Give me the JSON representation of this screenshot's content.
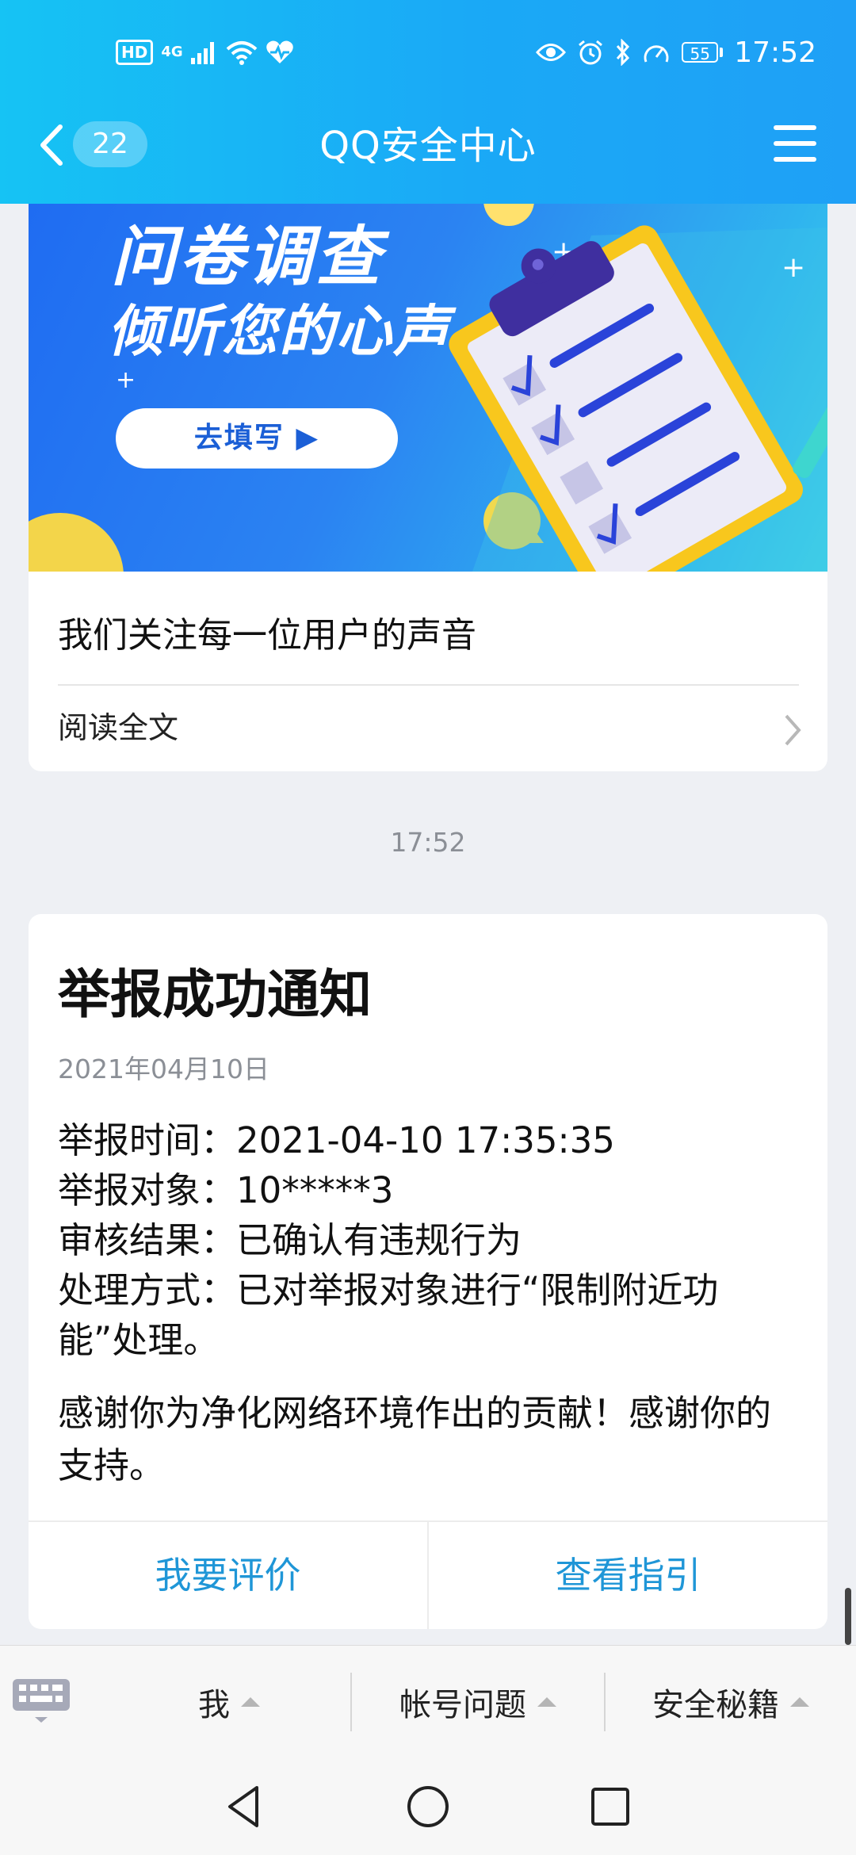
{
  "status_bar": {
    "left_icons": [
      "hd-icon",
      "4g-signal-icon",
      "wifi-icon",
      "heart-health-icon"
    ],
    "hd_label": "HD",
    "network_label": "4G",
    "right_icons": [
      "eye-icon",
      "alarm-icon",
      "bluetooth-icon",
      "speed-icon"
    ],
    "battery": "55",
    "time": "17:52"
  },
  "header": {
    "unread_count": "22",
    "title": "QQ安全中心"
  },
  "survey_card": {
    "banner_title": "问卷调查",
    "banner_subtitle": "倾听您的心声",
    "fill_button": "去填写 ▶",
    "description": "我们关注每一位用户的声音",
    "read_full": "阅读全文"
  },
  "timestamp": "17:52",
  "notice_card": {
    "title": "举报成功通知",
    "date": "2021年04月10日",
    "details": [
      "举报时间：2021-04-10 17:35:35",
      "举报对象：10*****3",
      "审核结果：已确认有违规行为",
      "处理方式：已对举报对象进行“限制附近功能”处理。"
    ],
    "thanks": "感谢你为净化网络环境作出的贡献！感谢你的支持。",
    "action_rate": "我要评价",
    "action_guide": "查看指引"
  },
  "bottom_menu": {
    "items": [
      "我",
      "帐号问题",
      "安全秘籍"
    ]
  },
  "colors": {
    "header_start": "#16c3f4",
    "header_end": "#1fa0f6",
    "action_blue": "#1f96d7",
    "banner_blue": "#1f6cf2"
  }
}
